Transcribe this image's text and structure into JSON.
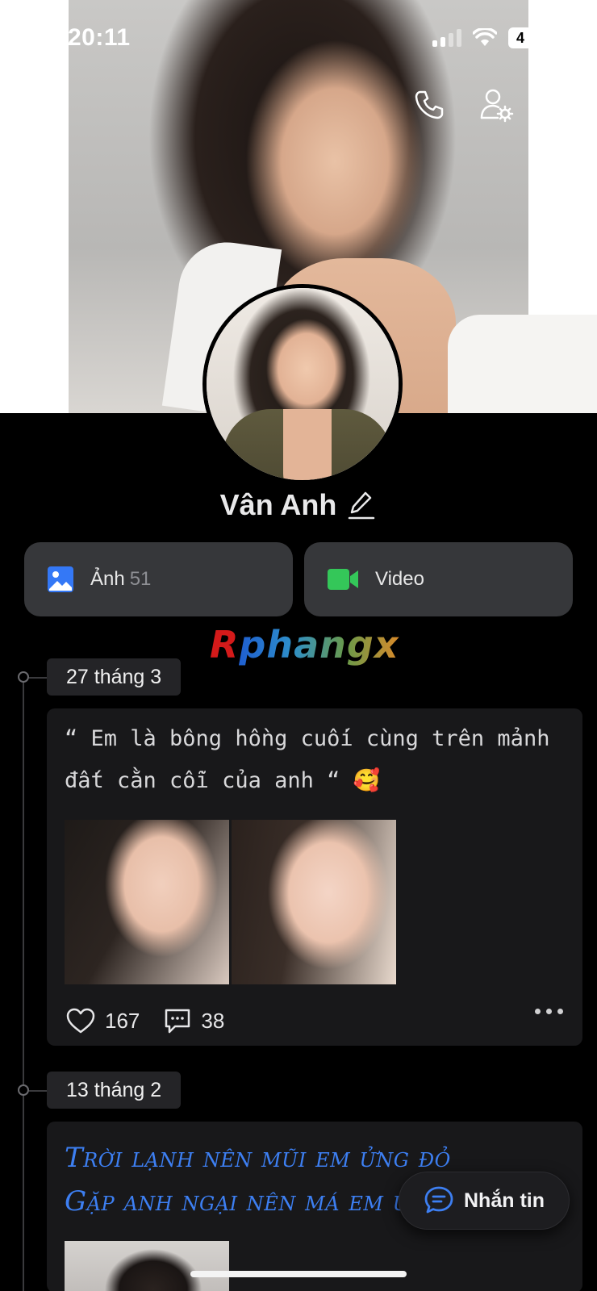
{
  "status_bar": {
    "time": "20:11",
    "battery": "4"
  },
  "profile": {
    "name": "Vân Anh"
  },
  "media": {
    "photos_label": "Ảnh",
    "photos_count": "51",
    "video_label": "Video"
  },
  "watermark": "Rphangx",
  "posts": [
    {
      "date": "27 tháng 3",
      "text": "“ Em là bông hồng cuối cùng trên mảnh đất cằn cỗi của anh “ 🥰",
      "likes": "167",
      "comments": "38"
    },
    {
      "date": "13 tháng 2",
      "text_line1": "Trời lạnh nên mũi em ửng đỏ",
      "text_line2": "Gặp anh ngại nên má em ửng hồn"
    }
  ],
  "fab": {
    "label": "Nhắn tin"
  },
  "colors": {
    "accent_blue": "#3d7ff2",
    "video_green": "#34c759",
    "card_bg": "#18181a",
    "button_bg": "#36373a"
  },
  "icons": [
    "back-icon",
    "phone-icon",
    "user-settings-icon",
    "more-icon",
    "edit-icon",
    "image-icon",
    "video-camera-icon",
    "heart-icon",
    "comment-icon",
    "message-icon"
  ]
}
